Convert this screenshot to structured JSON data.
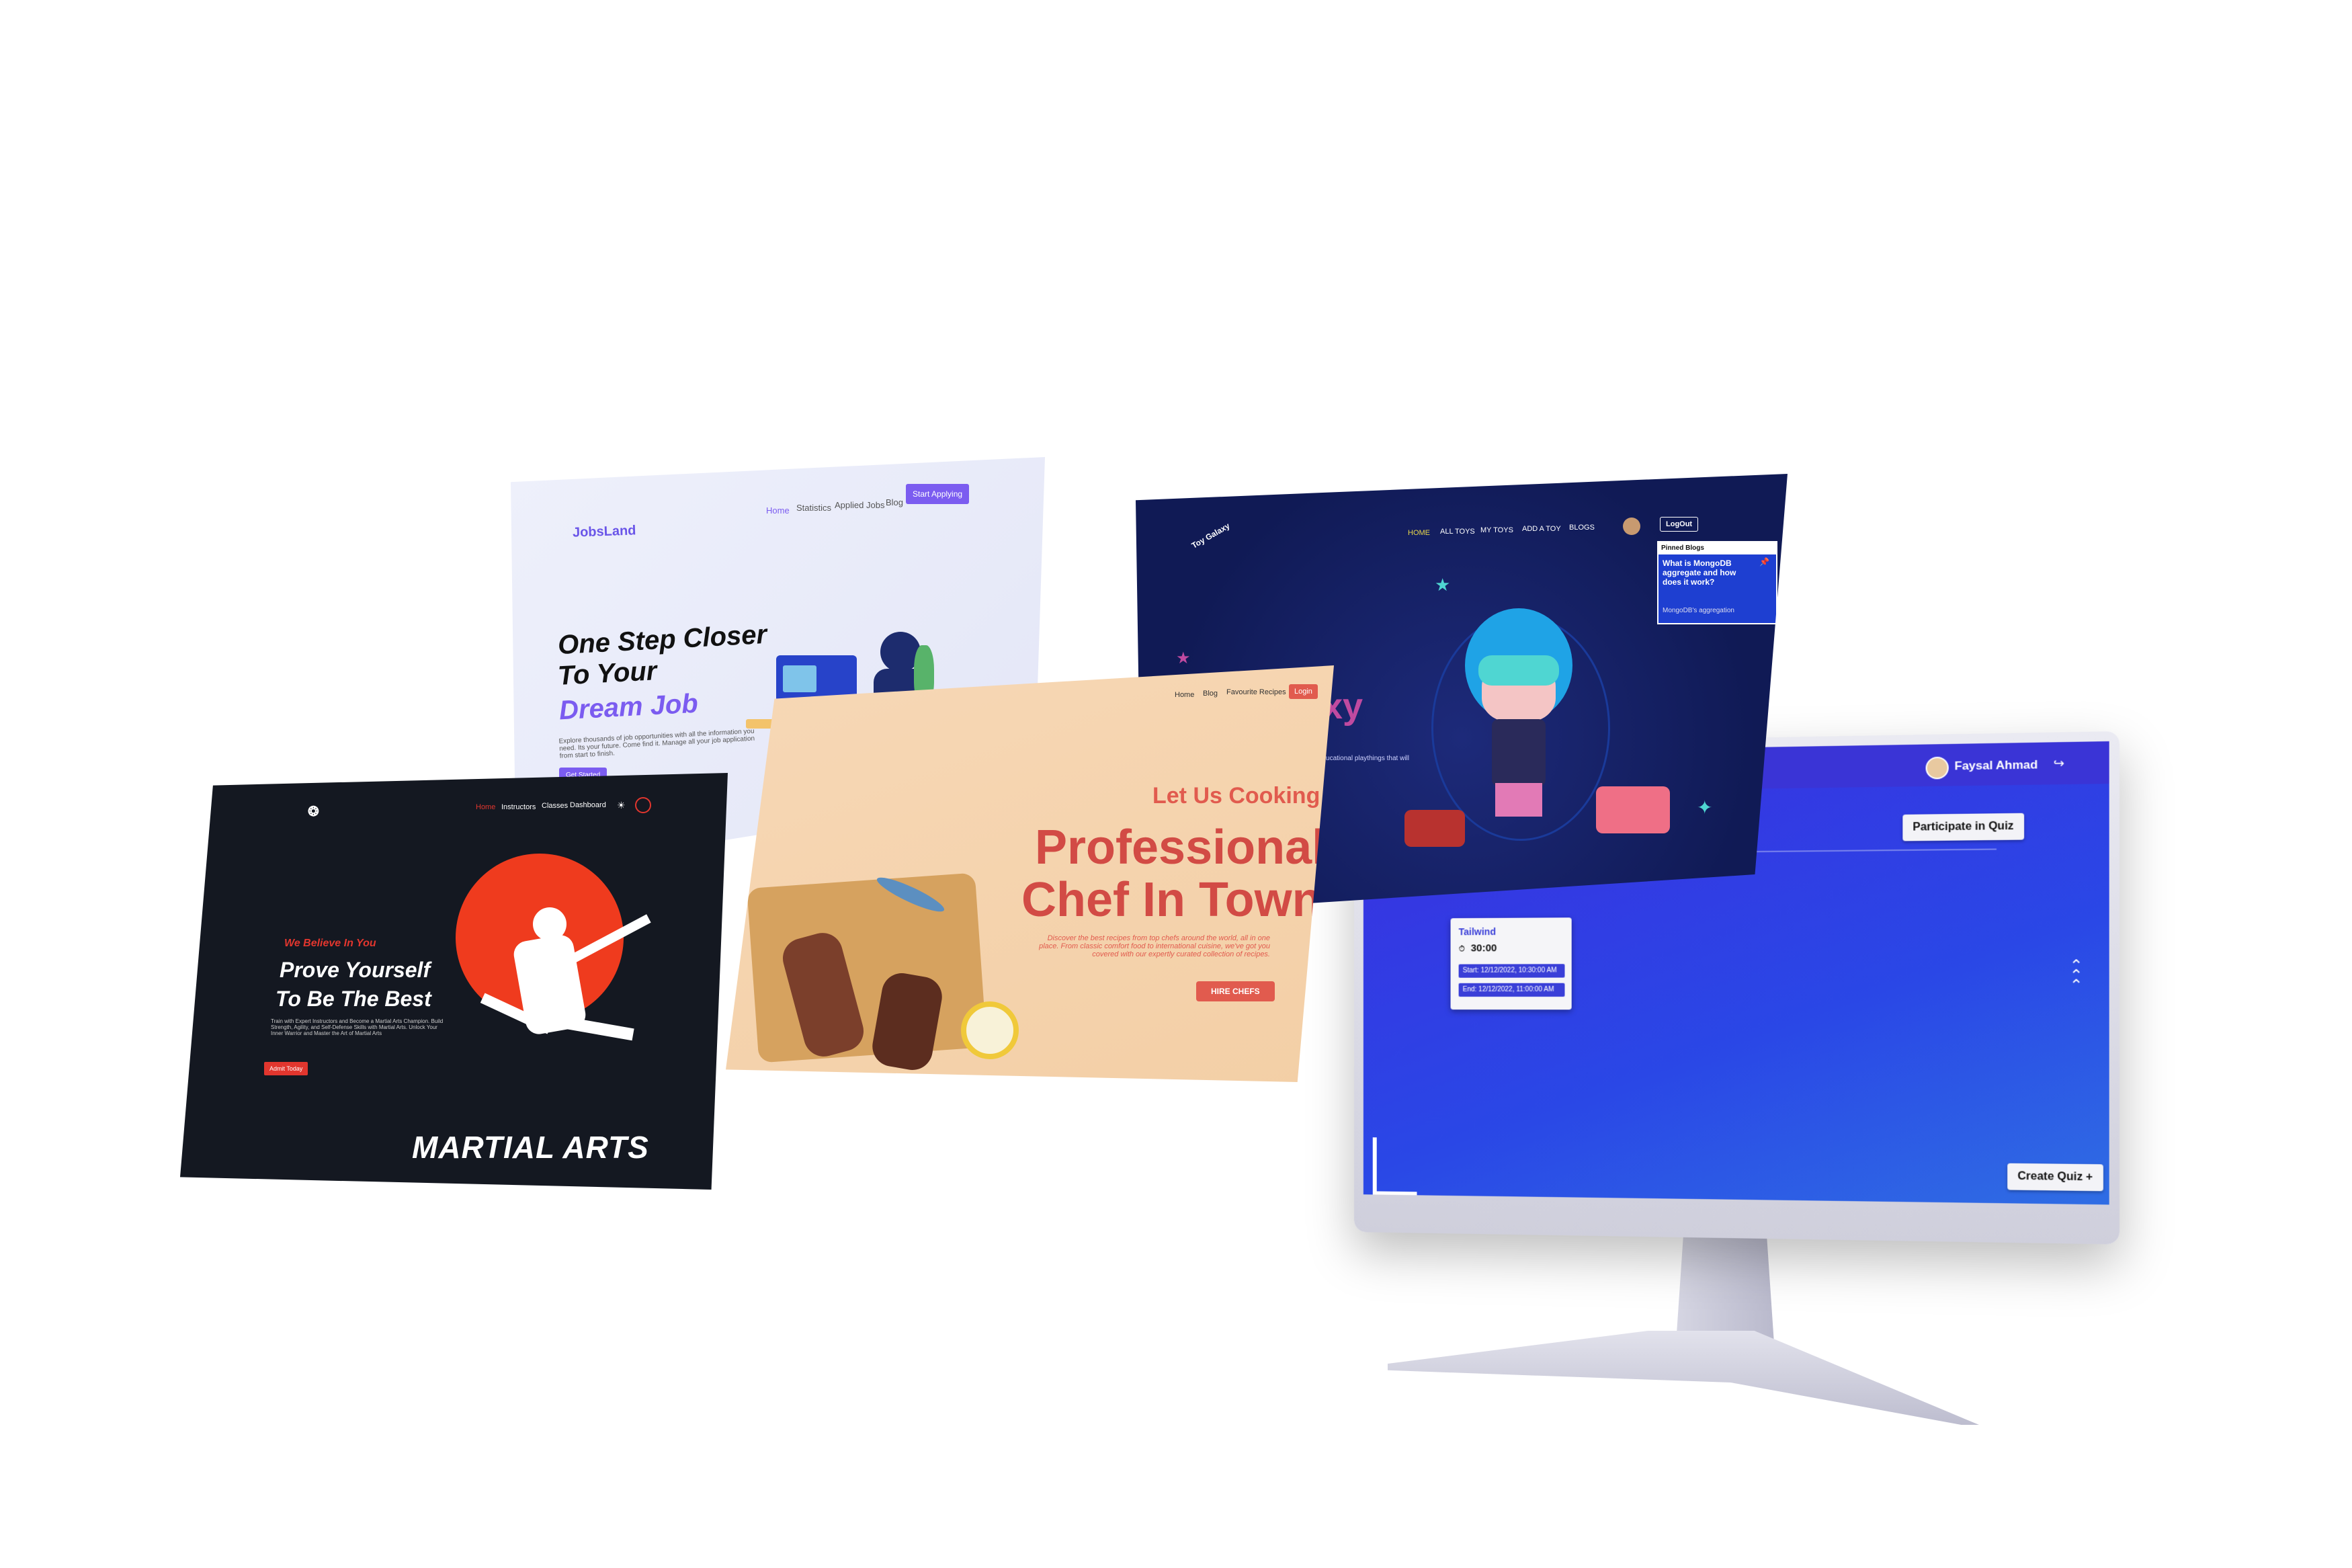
{
  "jobs": {
    "logo": "JobsLand",
    "nav": [
      "Home",
      "Statistics",
      "Applied Jobs",
      "Blog"
    ],
    "cta": "Start Applying",
    "headline_1": "One Step Closer",
    "headline_2": "To Your",
    "headline_accent": "Dream Job",
    "description": "Explore thousands of job opportunities with all the information you need. Its your future. Come find it. Manage all your job application from start to finish.",
    "button": "Get Started",
    "colors": {
      "accent": "#7b5cf0",
      "background": "#eceefa"
    }
  },
  "toys": {
    "logo": "Toy Galaxy",
    "nav": [
      "HOME",
      "ALL TOYS",
      "MY TOYS",
      "ADD A TOY",
      "BLOGS"
    ],
    "logout": "LogOut",
    "pinned_title": "Pinned Blogs",
    "pinned_question": "What is MongoDB aggregate and how does it work?",
    "pinned_snippet": "MongoDB's aggregation",
    "hero_fragment": "xy",
    "tagline_fragment": "nd educational playthings that will",
    "colors": {
      "background": "#121c5c",
      "accent": "#e9d84a"
    }
  },
  "quiz": {
    "user_name": "Faysal Ahmad",
    "participate": "Participate in Quiz",
    "card_title": "Tailwind",
    "card_time": "30:00",
    "start": "Start: 12/12/2022, 10:30:00 AM",
    "end": "End: 12/12/2022, 11:00:00 AM",
    "create": "Create Quiz +",
    "colors": {
      "screen": "#3037dc"
    }
  },
  "martial": {
    "nav": [
      "Home",
      "Instructors",
      "Classes",
      "Dashboard"
    ],
    "tagline": "We Believe In You",
    "headline_1": "Prove Yourself",
    "headline_2": "To Be The Best",
    "description": "Train with Expert Instructors and Become a Martial Arts Champion. Build Strength, Agility, and Self-Defense Skills with Martial Arts. Unlock Your Inner Warrior and Master the Art of Martial Arts",
    "button": "Admit Today",
    "logo_text": "MARTIAL ARTS",
    "colors": {
      "background": "#141821",
      "accent": "#e2362e"
    }
  },
  "chef": {
    "nav": [
      "Home",
      "Blog",
      "Favourite Recipes"
    ],
    "login": "Login",
    "tagline": "Let Us Cooking",
    "headline_1": "Professional",
    "headline_2": "Chef In Town",
    "description": "Discover the best recipes from top chefs around the world, all in one place. From classic comfort food to international cuisine, we've got you covered with our expertly curated collection of recipes.",
    "button": "HIRE CHEFS",
    "colors": {
      "background": "#f5d3ae",
      "accent": "#d9534f"
    }
  }
}
